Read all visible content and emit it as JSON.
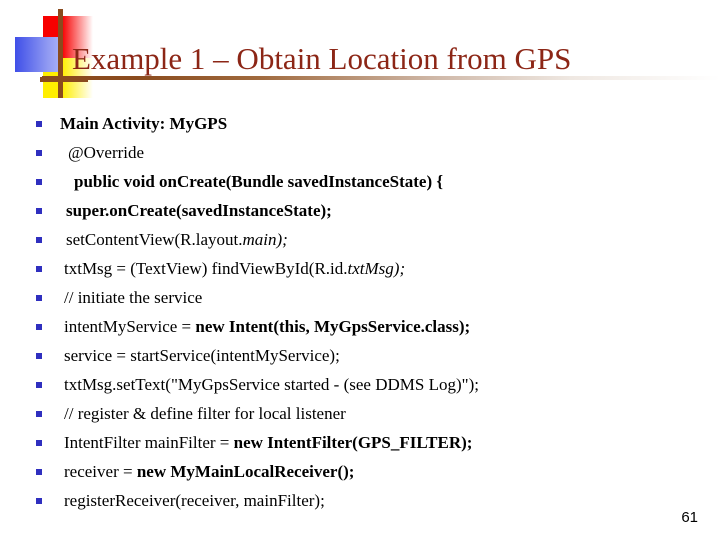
{
  "slide": {
    "title": "Example 1 – Obtain Location from GPS",
    "slide_number": "61",
    "title_color": "#8c2616",
    "bullet_color": "#2f2fbf",
    "rule_color": "#8a4b1e",
    "background_color": "#ffffff"
  },
  "logo": {
    "red_color": "#f70000",
    "yellow_color": "#ffee00",
    "blue_color": "#3f4fe8",
    "bar_color": "#8a4b1e"
  },
  "bullets": [
    {
      "indent": 0,
      "segments": [
        {
          "text": "Main Activity: MyGPS",
          "style": "b"
        }
      ]
    },
    {
      "indent": 1,
      "segments": [
        {
          "text": "@Override",
          "style": ""
        }
      ]
    },
    {
      "indent": 2,
      "segments": [
        {
          "text": "public void onCreate(Bundle savedInstanceState) {",
          "style": "b"
        }
      ]
    },
    {
      "indent": 3,
      "segments": [
        {
          "text": "super.onCreate(savedInstanceState);",
          "style": "b"
        }
      ]
    },
    {
      "indent": 3,
      "segments": [
        {
          "text": "setContentView(R.layout.",
          "style": ""
        },
        {
          "text": "main);",
          "style": "i"
        }
      ]
    },
    {
      "indent": 4,
      "segments": [
        {
          "text": "txtMsg = (TextView) findViewById(R.id.",
          "style": ""
        },
        {
          "text": "txtMsg);",
          "style": "i"
        }
      ]
    },
    {
      "indent": 4,
      "segments": [
        {
          "text": "// initiate the service",
          "style": ""
        }
      ]
    },
    {
      "indent": 4,
      "segments": [
        {
          "text": "intentMyService = ",
          "style": ""
        },
        {
          "text": "new Intent(this, MyGpsService.class);",
          "style": "b"
        }
      ]
    },
    {
      "indent": 4,
      "segments": [
        {
          "text": "service = startService(intentMyService);",
          "style": ""
        }
      ]
    },
    {
      "indent": 4,
      "segments": [
        {
          "text": "txtMsg.setText(\"MyGpsService started - (see DDMS Log)\");",
          "style": ""
        }
      ]
    },
    {
      "indent": 4,
      "segments": [
        {
          "text": "// register & define filter for local listener",
          "style": ""
        }
      ]
    },
    {
      "indent": 4,
      "segments": [
        {
          "text": "IntentFilter mainFilter = ",
          "style": ""
        },
        {
          "text": "new IntentFilter(GPS_FILTER);",
          "style": "b"
        }
      ]
    },
    {
      "indent": 4,
      "segments": [
        {
          "text": "receiver = ",
          "style": ""
        },
        {
          "text": "new MyMainLocalReceiver();",
          "style": "b"
        }
      ]
    },
    {
      "indent": 4,
      "segments": [
        {
          "text": "registerReceiver(receiver, mainFilter);",
          "style": ""
        }
      ]
    }
  ]
}
